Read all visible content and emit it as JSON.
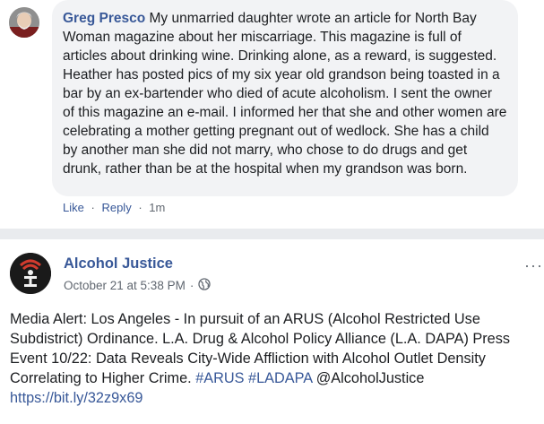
{
  "comment": {
    "author": "Greg Presco",
    "text": " My unmarried daughter wrote an article for North Bay Woman magazine about her miscarriage. This magazine is full of articles about drinking wine. Drinking alone, as a reward, is suggested. Heather has posted pics of my six year old grandson being toasted in a bar by an ex-bartender who died of acute alcoholism. I sent the owner of this magazine an e-mail. I informed her that she and other women are celebrating a mother getting pregnant out of wedlock. She has a child by another man she did not marry, who chose to do drugs and get drunk, rather than be at the hospital when my grandson was born.",
    "like_label": "Like",
    "reply_label": "Reply",
    "separator": "·",
    "time": "1m"
  },
  "post": {
    "page_name": "Alcohol Justice",
    "date": "October 21 at 5:38 PM",
    "meta_separator": "·",
    "more_label": "···",
    "text_main": "Media Alert: Los Angeles - In pursuit of an ARUS (Alcohol Restricted Use Subdistrict) Ordinance. L.A. Drug & Alcohol Policy Alliance (L.A. DAPA) Press Event 10/22: Data Reveals City-Wide Affliction with Alcohol Outlet Density Correlating to Higher Crime.",
    "hashtag1": "#ARUS",
    "hashtag2": "#LADAPA",
    "mention": "@AlcoholJustice",
    "link": "https://bit.ly/32z9x69"
  },
  "icons": {
    "audience": "globe-icon",
    "author_avatar": "user-avatar",
    "page_avatar": "alcohol-justice-logo"
  }
}
